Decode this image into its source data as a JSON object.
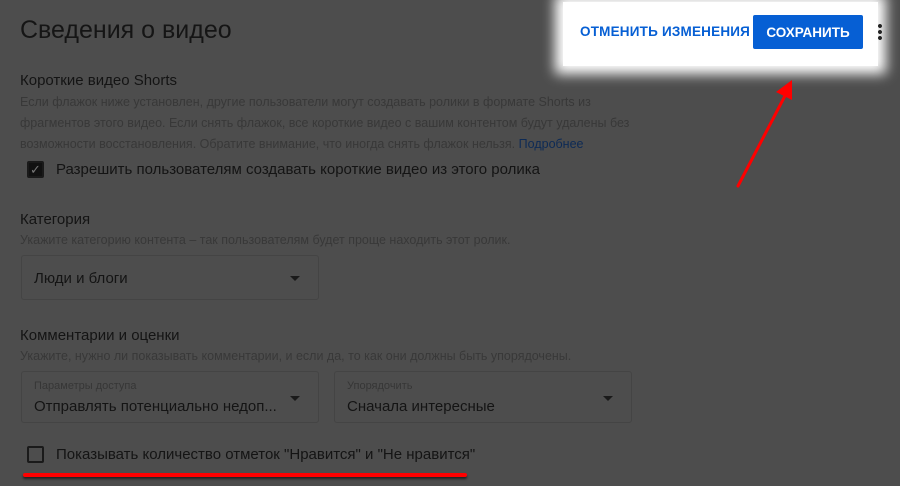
{
  "header": {
    "title": "Сведения о видео",
    "cancel_label": "ОТМЕНИТЬ ИЗМЕНЕНИЯ",
    "save_label": "СОХРАНИТЬ",
    "more_icon": "⋮"
  },
  "shorts": {
    "heading": "Короткие видео Shorts",
    "description": "Если флажок ниже установлен, другие пользователи могут создавать ролики в формате Shorts из фрагментов этого видео. Если снять флажок, все короткие видео с вашим контентом будут удалены без возможности восстановления. Обратите внимание, что иногда снять флажок нельзя.",
    "link": "Подробнее",
    "checkbox_label": "Разрешить пользователям создавать короткие видео из этого ролика",
    "checked": true
  },
  "category": {
    "heading": "Категория",
    "description": "Укажите категорию контента – так пользователям будет проще находить этот ролик.",
    "value": "Люди и блоги"
  },
  "comments": {
    "heading": "Комментарии и оценки",
    "description": "Укажите, нужно ли показывать комментарии, и если да, то как они должны быть упорядочены.",
    "access_label": "Параметры доступа",
    "access_value": "Отправлять потенциально недоп...",
    "sort_label": "Упорядочить",
    "sort_value": "Сначала интересные",
    "likes_checkbox_label": "Показывать количество отметок \"Нравится\" и \"Не нравится\"",
    "likes_checked": false
  },
  "colors": {
    "accent": "#065fd4",
    "annotation": "#ff0000"
  }
}
